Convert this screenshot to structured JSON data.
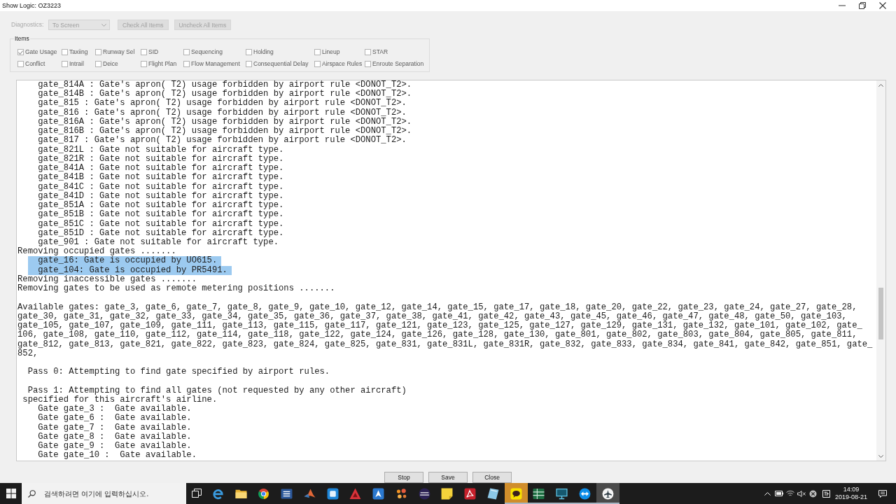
{
  "window": {
    "title": "Show Logic: OZ3223"
  },
  "toolbar": {
    "diagnostics": {
      "label": "Diagnostics:",
      "value": "To Screen",
      "disabled": true
    },
    "buttons": [
      {
        "label": "Check All Items",
        "disabled": true
      },
      {
        "label": "Uncheck All Items",
        "disabled": true
      }
    ]
  },
  "items": {
    "title": "Items",
    "checkboxes": [
      {
        "label": "Gate Usage",
        "checked": true
      },
      {
        "label": "Taxiing",
        "checked": false
      },
      {
        "label": "Runway Sel",
        "checked": false
      },
      {
        "label": "SID",
        "checked": false
      },
      {
        "label": "Sequencing",
        "checked": false
      },
      {
        "label": "Holding",
        "checked": false
      },
      {
        "label": "Lineup",
        "checked": false
      },
      {
        "label": "STAR",
        "checked": false
      },
      {
        "label": "Conflict",
        "checked": false
      },
      {
        "label": "Intrail",
        "checked": false
      },
      {
        "label": "Deice",
        "checked": false
      },
      {
        "label": "Flight Plan",
        "checked": false
      },
      {
        "label": "Flow Management",
        "checked": false
      },
      {
        "label": "Consequential Delay",
        "checked": false
      },
      {
        "label": "Airspace Rules",
        "checked": false
      },
      {
        "label": "Enroute Separation",
        "checked": false
      }
    ]
  },
  "log": {
    "blocks": [
      {
        "lines": [
          {
            "kind": "detail",
            "text": "gate_814A : Gate's apron( T2) usage forbidden by airport rule <DONOT_T2>.",
            "selected": false
          },
          {
            "kind": "detail",
            "text": "gate_814B : Gate's apron( T2) usage forbidden by airport rule <DONOT_T2>.",
            "selected": false
          },
          {
            "kind": "detail",
            "text": "gate_815 : Gate's apron( T2) usage forbidden by airport rule <DONOT_T2>.",
            "selected": false
          },
          {
            "kind": "detail",
            "text": "gate_816 : Gate's apron( T2) usage forbidden by airport rule <DONOT_T2>.",
            "selected": false
          },
          {
            "kind": "detail",
            "text": "gate_816A : Gate's apron( T2) usage forbidden by airport rule <DONOT_T2>.",
            "selected": false
          },
          {
            "kind": "detail",
            "text": "gate_816B : Gate's apron( T2) usage forbidden by airport rule <DONOT_T2>.",
            "selected": false
          },
          {
            "kind": "detail",
            "text": "gate_817 : Gate's apron( T2) usage forbidden by airport rule <DONOT_T2>.",
            "selected": false
          },
          {
            "kind": "detail",
            "text": "gate_821L : Gate not suitable for aircraft type.",
            "selected": false
          },
          {
            "kind": "detail",
            "text": "gate_821R : Gate not suitable for aircraft type.",
            "selected": false
          },
          {
            "kind": "detail",
            "text": "gate_841A : Gate not suitable for aircraft type.",
            "selected": false
          },
          {
            "kind": "detail",
            "text": "gate_841B : Gate not suitable for aircraft type.",
            "selected": false
          },
          {
            "kind": "detail",
            "text": "gate_841C : Gate not suitable for aircraft type.",
            "selected": false
          },
          {
            "kind": "detail",
            "text": "gate_841D : Gate not suitable for aircraft type.",
            "selected": false
          },
          {
            "kind": "detail",
            "text": "gate_851A : Gate not suitable for aircraft type.",
            "selected": false
          },
          {
            "kind": "detail",
            "text": "gate_851B : Gate not suitable for aircraft type.",
            "selected": false
          },
          {
            "kind": "detail",
            "text": "gate_851C : Gate not suitable for aircraft type.",
            "selected": false
          },
          {
            "kind": "detail",
            "text": "gate_851D : Gate not suitable for aircraft type.",
            "selected": false
          },
          {
            "kind": "detail",
            "text": "gate_901 : Gate not suitable for aircraft type.",
            "selected": false
          },
          {
            "kind": "step",
            "text": "Removing occupied gates .......",
            "selected": false
          },
          {
            "kind": "detail",
            "text": "gate_16: Gate is occupied by UO615.",
            "selected": true
          },
          {
            "kind": "detail",
            "text": "gate_104: Gate is occupied by PR5491.",
            "selected": true
          },
          {
            "kind": "step",
            "text": "Removing inaccessible gates .......",
            "selected": false
          },
          {
            "kind": "step",
            "text": "Removing gates to be used as remote metering positions .......",
            "selected": false
          }
        ]
      },
      {
        "lines": [
          {
            "kind": "step",
            "text": "Available gates: gate_3, gate_6, gate_7, gate_8, gate_9, gate_10, gate_12, gate_14, gate_15, gate_17, gate_18, gate_20, gate_22, gate_23, gate_24, gate_27, gate_28,",
            "selected": false
          },
          {
            "kind": "step",
            "text": "gate_30, gate_31, gate_32, gate_33, gate_34, gate_35, gate_36, gate_37, gate_38, gate_41, gate_42, gate_43, gate_45, gate_46, gate_47, gate_48, gate_50, gate_103,",
            "selected": false
          },
          {
            "kind": "step",
            "text": "gate_105, gate_107, gate_109, gate_111, gate_113, gate_115, gate_117, gate_121, gate_123, gate_125, gate_127, gate_129, gate_131, gate_132, gate_101, gate_102, gate_",
            "selected": false
          },
          {
            "kind": "step",
            "text": "106, gate_108, gate_110, gate_112, gate_114, gate_118, gate_122, gate_124, gate_126, gate_128, gate_130, gate_801, gate_802, gate_803, gate_804, gate_805, gate_811,",
            "selected": false
          },
          {
            "kind": "step",
            "text": "gate_812, gate_813, gate_821, gate_822, gate_823, gate_824, gate_825, gate_831, gate_831L, gate_831R, gate_832, gate_833, gate_834, gate_841, gate_842, gate_851, gate_",
            "selected": false
          },
          {
            "kind": "step",
            "text": "852,",
            "selected": false
          }
        ]
      },
      {
        "lines": [
          {
            "kind": "pass",
            "text": "Pass 0: Attempting to find gate specified by airport rules.",
            "selected": false
          }
        ]
      },
      {
        "lines": [
          {
            "kind": "pass",
            "text": "Pass 1: Attempting to find all gates (not requested by any other aircraft)",
            "selected": false
          },
          {
            "kind": "note",
            "text": "specified for this aircraft's airline.",
            "selected": false
          },
          {
            "kind": "detail",
            "text": "Gate gate_3 :  Gate available.",
            "selected": false
          },
          {
            "kind": "detail",
            "text": "Gate gate_6 :  Gate available.",
            "selected": false
          },
          {
            "kind": "detail",
            "text": "Gate gate_7 :  Gate available.",
            "selected": false
          },
          {
            "kind": "detail",
            "text": "Gate gate_8 :  Gate available.",
            "selected": false
          },
          {
            "kind": "detail",
            "text": "Gate gate_9 :  Gate available.",
            "selected": false
          },
          {
            "kind": "detail",
            "text": "Gate gate_10 :  Gate available.",
            "selected": false
          }
        ]
      }
    ]
  },
  "buttons": [
    "Stop",
    "Save",
    "Close"
  ],
  "taskbar": {
    "search": {
      "placeholder": "검색하려면 여기에 입력하십시오."
    },
    "apps": [
      {
        "running": false,
        "selected": false,
        "attention": false
      },
      {
        "running": false,
        "selected": false,
        "attention": false
      },
      {
        "running": false,
        "selected": false,
        "attention": false
      },
      {
        "running": false,
        "selected": false,
        "attention": false
      },
      {
        "running": false,
        "selected": false,
        "attention": false
      },
      {
        "running": false,
        "selected": false,
        "attention": false
      },
      {
        "running": false,
        "selected": false,
        "attention": false
      },
      {
        "running": false,
        "selected": false,
        "attention": false
      },
      {
        "running": false,
        "selected": false,
        "attention": false
      },
      {
        "running": false,
        "selected": false,
        "attention": false
      },
      {
        "running": false,
        "selected": false,
        "attention": false
      },
      {
        "running": false,
        "selected": false,
        "attention": false
      },
      {
        "running": false,
        "selected": false,
        "attention": false
      },
      {
        "running": true,
        "selected": false,
        "attention": true
      },
      {
        "running": true,
        "selected": false,
        "attention": false
      },
      {
        "running": true,
        "selected": false,
        "attention": false
      },
      {
        "running": true,
        "selected": false,
        "attention": false
      },
      {
        "running": true,
        "selected": true,
        "attention": false
      }
    ],
    "clock": {
      "time": "14:09",
      "date": "2019-08-21"
    }
  }
}
